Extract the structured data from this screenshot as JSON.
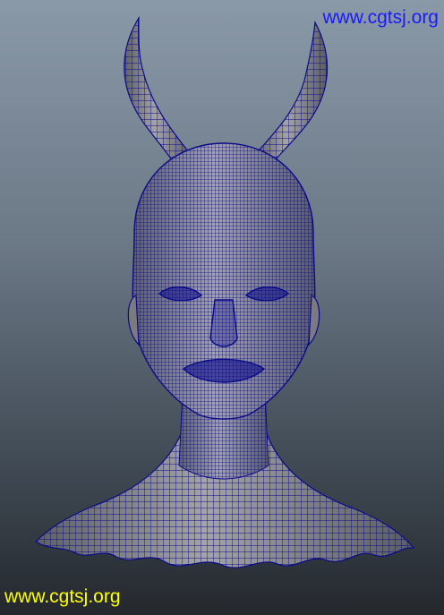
{
  "viewport": {
    "background_top": "#8a99a8",
    "background_bottom": "#24282d",
    "mesh_fill": "#8c8c8c",
    "wire_color": "#0a0a8a",
    "model": "head-bust-with-horns-wireframe"
  },
  "watermarks": {
    "top_text": "www.cgtsj.org",
    "top_color": "#1a1aff",
    "bottom_text": "www.cgtsj.org",
    "bottom_color": "#ffff00"
  }
}
